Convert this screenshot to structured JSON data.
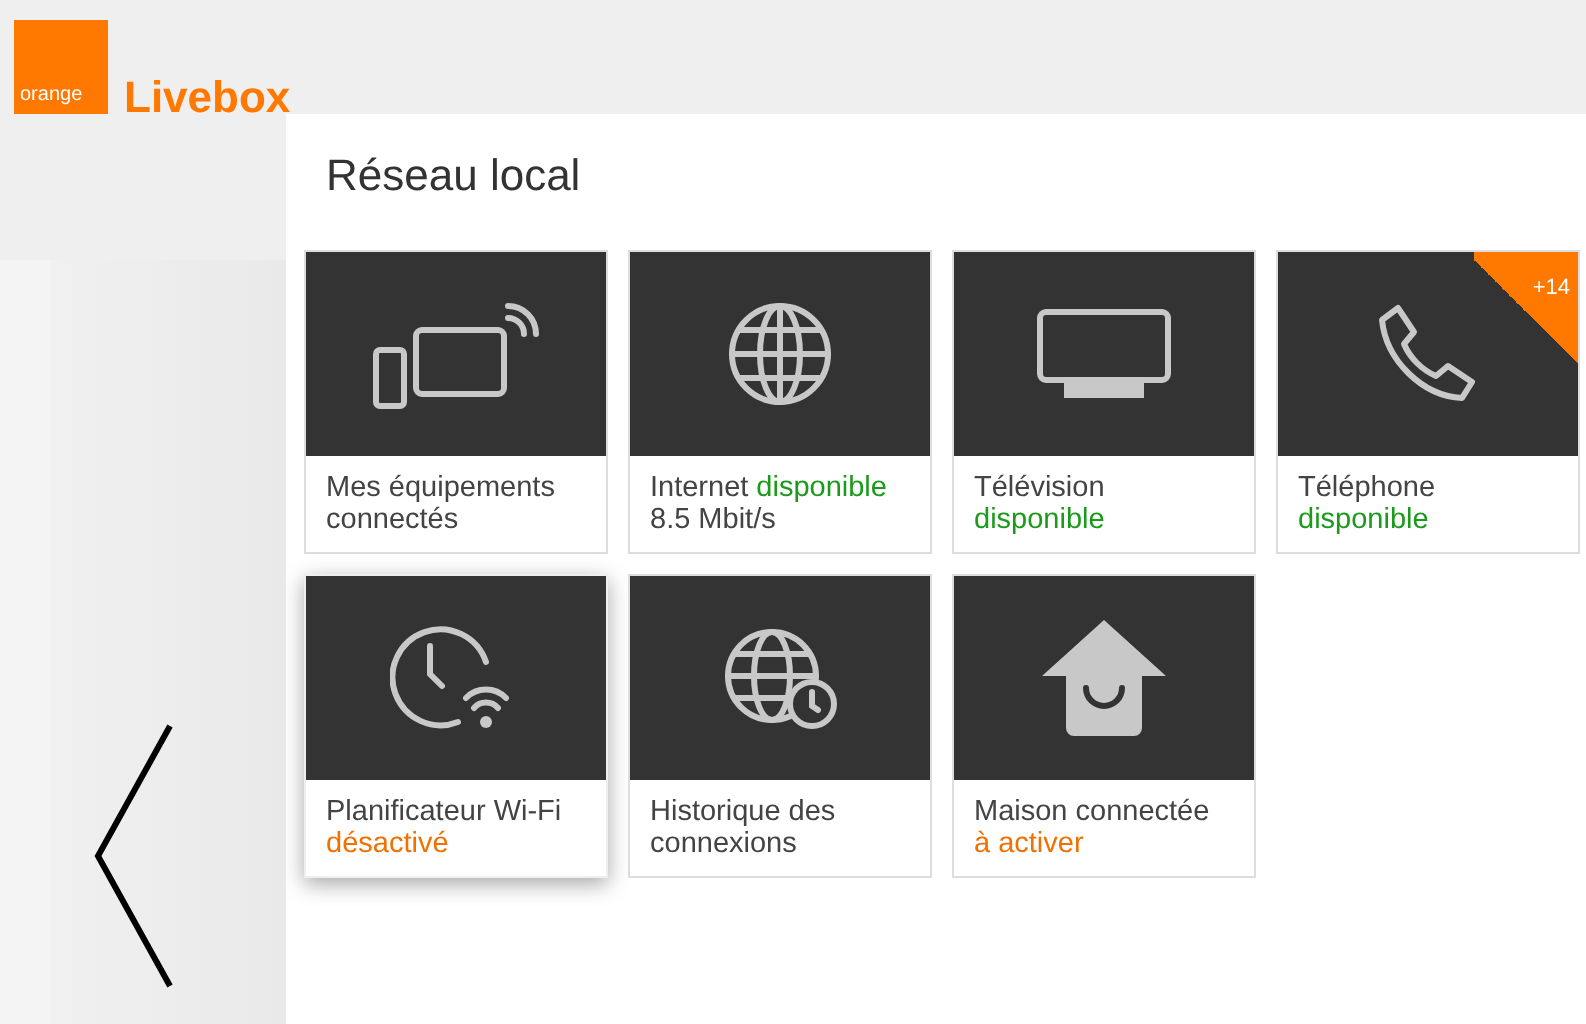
{
  "header": {
    "logo_text": "orange",
    "product": "Livebox"
  },
  "page_title": "Réseau local",
  "tiles": [
    {
      "kind": "devices",
      "highlighted": false,
      "lines": [
        [
          {
            "text": "Mes équipements"
          }
        ],
        [
          {
            "text": "connectés"
          }
        ]
      ]
    },
    {
      "kind": "globe",
      "highlighted": false,
      "lines": [
        [
          {
            "text": "Internet"
          },
          {
            "text": "disponible",
            "color": "#1c9a1c"
          }
        ],
        [
          {
            "text": "8.5 Mbit/s"
          }
        ]
      ]
    },
    {
      "kind": "tv",
      "highlighted": false,
      "lines": [
        [
          {
            "text": "Télévision"
          }
        ],
        [
          {
            "text": "disponible",
            "color": "#1c9a1c"
          }
        ]
      ]
    },
    {
      "kind": "phone",
      "highlighted": false,
      "badge": "+14",
      "lines": [
        [
          {
            "text": "Téléphone"
          }
        ],
        [
          {
            "text": "disponible",
            "color": "#1c9a1c"
          }
        ]
      ]
    },
    {
      "kind": "clock-wifi",
      "highlighted": true,
      "lines": [
        [
          {
            "text": "Planificateur Wi-Fi"
          }
        ],
        [
          {
            "text": "désactivé",
            "color": "#f07000"
          }
        ]
      ]
    },
    {
      "kind": "globe-history",
      "highlighted": false,
      "lines": [
        [
          {
            "text": "Historique des"
          }
        ],
        [
          {
            "text": "connexions"
          }
        ]
      ]
    },
    {
      "kind": "home",
      "highlighted": false,
      "lines": [
        [
          {
            "text": "Maison connectée"
          }
        ],
        [
          {
            "text": "à activer",
            "color": "#f07000"
          }
        ]
      ]
    }
  ]
}
